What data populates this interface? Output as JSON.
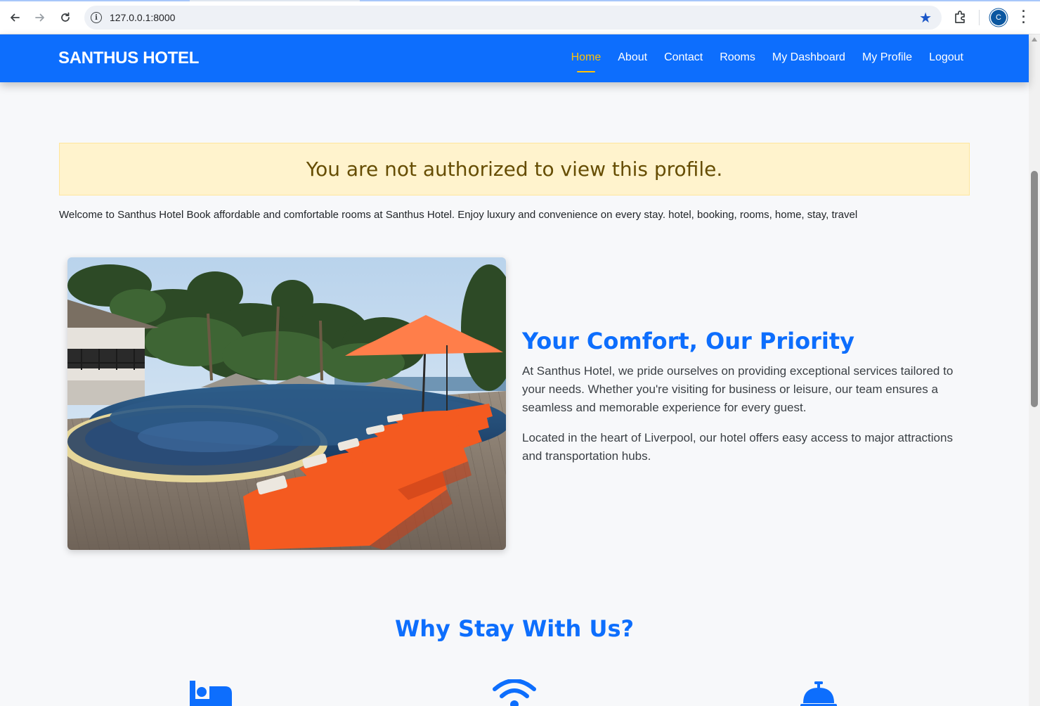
{
  "browser": {
    "url": "127.0.0.1:8000",
    "avatar_letter": "C",
    "accent": "#0b57a0"
  },
  "site": {
    "brand": "SANTHUS HOTEL",
    "nav": [
      {
        "label": "Home",
        "active": true
      },
      {
        "label": "About"
      },
      {
        "label": "Contact"
      },
      {
        "label": "Rooms"
      },
      {
        "label": "My Dashboard"
      },
      {
        "label": "My Profile"
      },
      {
        "label": "Logout"
      }
    ],
    "primary_color": "#0d6efd",
    "active_color": "#ffc107"
  },
  "alert": {
    "message": "You are not authorized to view this profile."
  },
  "welcome": "Welcome to Santhus Hotel Book affordable and comfortable rooms at Santhus Hotel. Enjoy luxury and convenience on every stay. hotel, booking, rooms, home, stay, travel",
  "comfort": {
    "title": "Your Comfort, Our Priority",
    "paragraph1": "At Santhus Hotel, we pride ourselves on providing exceptional services tailored to your needs. Whether you're visiting for business or leisure, our team ensures a seamless and memorable experience for every guest.",
    "paragraph2": "Located in the heart of Liverpool, our hotel offers easy access to major attractions and transportation hubs."
  },
  "why": {
    "title": "Why Stay With Us?",
    "icons": [
      "bed-icon",
      "wifi-icon",
      "service-bell-icon"
    ]
  }
}
